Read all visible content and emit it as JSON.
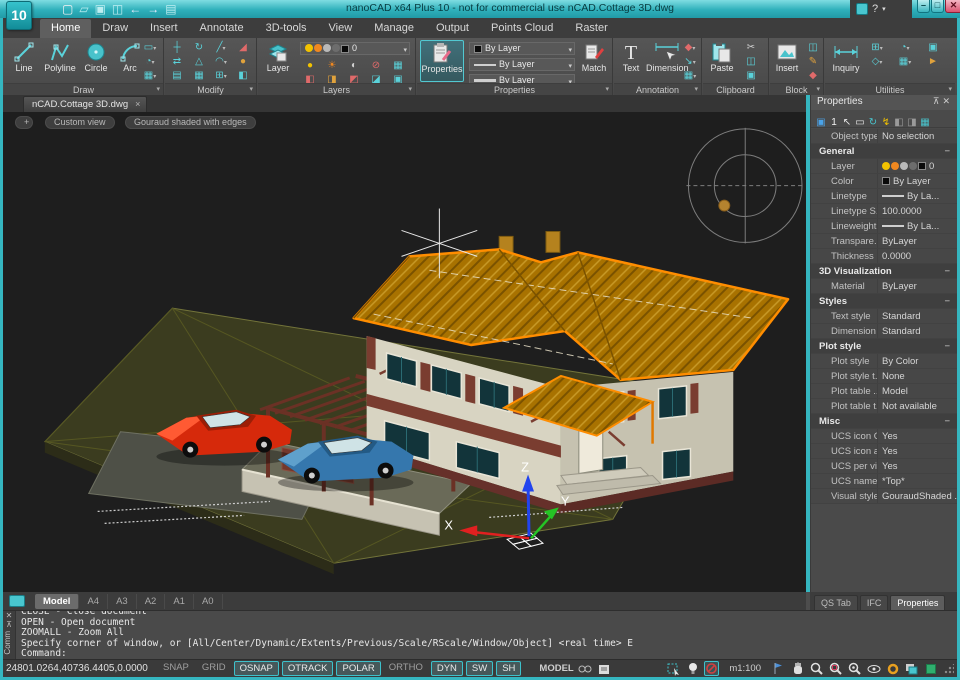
{
  "window": {
    "title": "nanoCAD x64 Plus 10 - not for commercial use nCAD.Cottage 3D.dwg",
    "logo": "10",
    "help_label": "?"
  },
  "menu": {
    "tabs": [
      "Home",
      "Draw",
      "Insert",
      "Annotate",
      "3D-tools",
      "View",
      "Manage",
      "Output",
      "Points Cloud",
      "Raster"
    ],
    "active_tab": "Home"
  },
  "ribbon": {
    "draw": {
      "label": "Draw",
      "buttons": [
        "Line",
        "Polyline",
        "Circle",
        "Arc"
      ]
    },
    "modify": {
      "label": "Modify"
    },
    "layers": {
      "label": "Layers",
      "big_button": "Layer",
      "current_layer": "0"
    },
    "properties": {
      "label": "Properties",
      "big_button": "Properties",
      "color_value": "By Layer",
      "linetype_value": "By Layer",
      "lineweight_value": "By Layer",
      "match_button": "Match"
    },
    "annotation": {
      "label": "Annotation",
      "buttons": [
        "Text",
        "Dimension"
      ]
    },
    "clipboard": {
      "label": "Clipboard",
      "big_button": "Paste"
    },
    "block": {
      "label": "Block",
      "big_button": "Insert"
    },
    "utilities": {
      "label": "Utilities",
      "big_button": "Inquiry"
    }
  },
  "document_tab": {
    "label": "nCAD.Cottage 3D.dwg",
    "close": "×"
  },
  "viewport": {
    "plus_control": "+",
    "view_control": "Custom view",
    "shading_control": "Gouraud shaded with edges",
    "axes": {
      "x": "X",
      "y": "Y",
      "z": "Z"
    }
  },
  "properties_panel": {
    "title": "Properties",
    "rows": [
      {
        "type": "row",
        "label": "Object type",
        "value": "No selection"
      },
      {
        "type": "section",
        "label": "General"
      },
      {
        "type": "row",
        "label": "Layer",
        "value": "0",
        "icons": "layer"
      },
      {
        "type": "row",
        "label": "Color",
        "value": "By Layer",
        "icons": "swatch"
      },
      {
        "type": "row",
        "label": "Linetype",
        "value": "By La...",
        "icons": "line"
      },
      {
        "type": "row",
        "label": "Linetype S...",
        "value": "100.0000"
      },
      {
        "type": "row",
        "label": "Lineweight",
        "value": "By La...",
        "icons": "line"
      },
      {
        "type": "row",
        "label": "Transpare...",
        "value": "ByLayer"
      },
      {
        "type": "row",
        "label": "Thickness",
        "value": "0.0000"
      },
      {
        "type": "section",
        "label": "3D Visualization"
      },
      {
        "type": "row",
        "label": "Material",
        "value": "ByLayer"
      },
      {
        "type": "section",
        "label": "Styles"
      },
      {
        "type": "row",
        "label": "Text style",
        "value": "Standard"
      },
      {
        "type": "row",
        "label": "Dimension ...",
        "value": "Standard"
      },
      {
        "type": "section",
        "label": "Plot style"
      },
      {
        "type": "row",
        "label": "Plot style",
        "value": "By Color"
      },
      {
        "type": "row",
        "label": "Plot style t...",
        "value": "None"
      },
      {
        "type": "row",
        "label": "Plot table ...",
        "value": "Model"
      },
      {
        "type": "row",
        "label": "Plot table t...",
        "value": "Not available"
      },
      {
        "type": "section",
        "label": "Misc"
      },
      {
        "type": "row",
        "label": "UCS icon On",
        "value": "Yes"
      },
      {
        "type": "row",
        "label": "UCS icon a...",
        "value": "Yes"
      },
      {
        "type": "row",
        "label": "UCS per vi...",
        "value": "Yes"
      },
      {
        "type": "row",
        "label": "UCS name",
        "value": "*Top*"
      },
      {
        "type": "row",
        "label": "Visual style",
        "value": "GouraudShaded ..."
      }
    ],
    "bottom_tabs": [
      "QS Tab",
      "IFC",
      "Properties"
    ],
    "active_bottom_tab": "Properties"
  },
  "layout_bar": {
    "tabs": [
      "Model",
      "A4",
      "A3",
      "A2",
      "A1",
      "A0"
    ],
    "active_tab": "Model"
  },
  "command_line": {
    "panel_label": "Comm",
    "history": [
      "CLOSE - Close document",
      "OPEN - Open document",
      "ZOOMALL - Zoom All",
      "Specify corner of window, or [All/Center/Dynamic/Extents/Previous/Scale/RScale/Window/Object] <real time> E"
    ],
    "prompt": "Command:"
  },
  "status_bar": {
    "coordinates": "24801.0264,40736.4405,0.0000",
    "toggles": [
      {
        "label": "SNAP",
        "active": false
      },
      {
        "label": "GRID",
        "active": false
      },
      {
        "label": "OSNAP",
        "active": true
      },
      {
        "label": "OTRACK",
        "active": true
      },
      {
        "label": "POLAR",
        "active": true
      },
      {
        "label": "ORTHO",
        "active": false
      },
      {
        "label": "DYN",
        "active": true
      },
      {
        "label": "SW",
        "active": true
      },
      {
        "label": "SH",
        "active": true
      }
    ],
    "model_label": "MODEL",
    "scale": "m1:100"
  },
  "colors": {
    "accent_teal": "#3ec1cb",
    "titlebar_teal": "#2fb0bb",
    "roof_orange": "#b07900",
    "roof_edge": "#ff8d00",
    "wall_cream": "#d8d4c2",
    "brick_red": "#7a3d30",
    "ground_olive": "#3b3c1f",
    "truck_red": "#d6290b",
    "truck_blue": "#3577ad",
    "axis_x_red": "#e02020",
    "axis_y_green": "#25c425",
    "axis_z_blue": "#2244ee"
  }
}
